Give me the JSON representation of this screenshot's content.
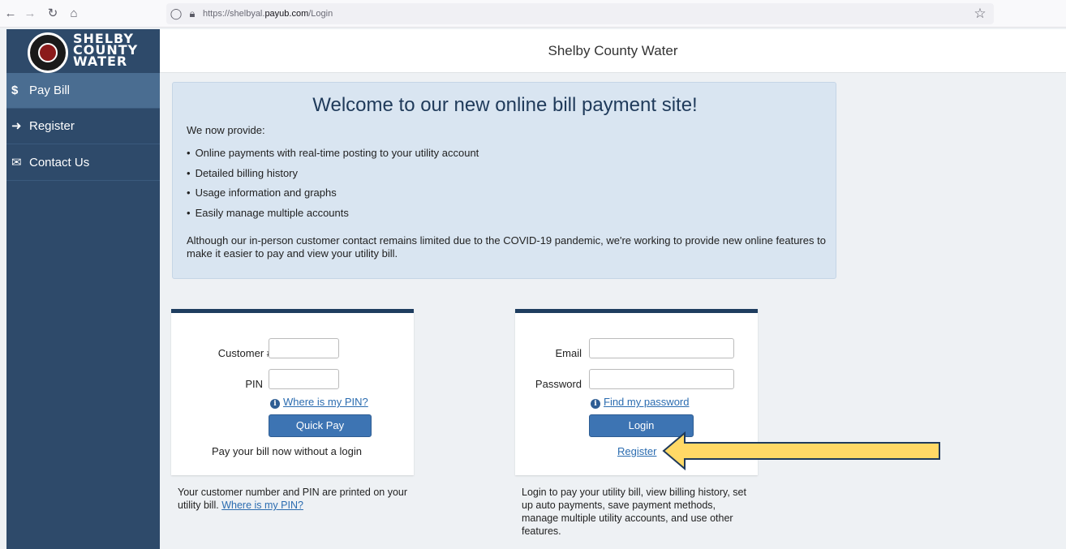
{
  "browser": {
    "url_prefix": "https://shelbyal.",
    "url_domain": "payub.com",
    "url_path": "/Login",
    "back_icon": "arrow-left-icon",
    "forward_icon": "arrow-right-icon",
    "reload_icon": "reload-icon",
    "home_icon": "home-icon",
    "shield_icon": "shield-icon",
    "lock_icon": "lock-icon",
    "bookmark_icon": "star-icon"
  },
  "logo": {
    "line1": "SHELBY",
    "line2": "COUNTY",
    "line3": "WATER"
  },
  "sidebar": {
    "items": [
      {
        "icon": "$",
        "label": "Pay Bill",
        "active": true
      },
      {
        "icon": "➜",
        "label": "Register",
        "active": false
      },
      {
        "icon": "✉",
        "label": "Contact Us",
        "active": false
      }
    ]
  },
  "header": {
    "title": "Shelby County Water"
  },
  "welcome": {
    "title": "Welcome to our new online bill payment site!",
    "intro": "We now provide:",
    "features": [
      "Online payments with real-time posting to your utility account",
      "Detailed billing history",
      "Usage information and graphs",
      "Easily manage multiple accounts"
    ],
    "note": "Although our in-person customer contact remains limited due to the COVID-19 pandemic, we're working to provide new online features to make it easier to pay and view your utility bill."
  },
  "quick_pay": {
    "customer_label": "Customer #",
    "customer_value": "",
    "pin_label": "PIN",
    "pin_value": "",
    "pin_help": "Where is my PIN?",
    "button": "Quick Pay",
    "caption": "Pay your bill now without a login",
    "below_text": "Your customer number and PIN are printed on your utility bill.",
    "below_link": "Where is my PIN?"
  },
  "login": {
    "email_label": "Email",
    "email_value": "",
    "password_label": "Password",
    "password_value": "",
    "password_help": "Find my password",
    "button": "Login",
    "register_link": "Register",
    "below_text": "Login to pay your utility bill, view billing history, set up auto payments, save payment methods, manage multiple utility accounts, and use other features."
  },
  "annotation": {
    "arrow_fill": "#ffd966",
    "arrow_stroke": "#1f3a5a"
  }
}
